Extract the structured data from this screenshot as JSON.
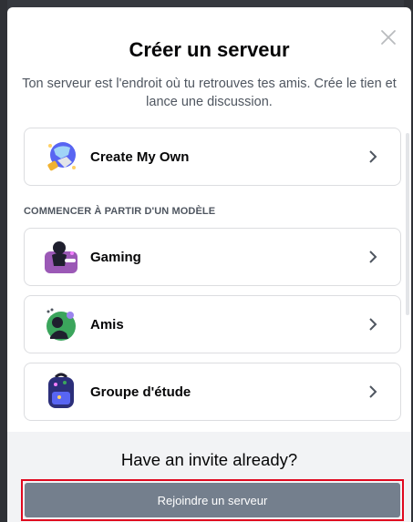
{
  "modal": {
    "title": "Créer un serveur",
    "subtitle": "Ton serveur est l'endroit où tu retrouves tes amis. Crée le tien et lance une discussion."
  },
  "create_own": {
    "label": "Create My Own",
    "icon": "globe-icon"
  },
  "templates": {
    "section_label": "COMMENCER À PARTIR D'UN MODÈLE",
    "items": [
      {
        "label": "Gaming",
        "icon": "gaming-icon"
      },
      {
        "label": "Amis",
        "icon": "friends-icon"
      },
      {
        "label": "Groupe d'étude",
        "icon": "backpack-icon"
      }
    ]
  },
  "footer": {
    "title": "Have an invite already?",
    "join_label": "Rejoindre un serveur"
  },
  "colors": {
    "accent": "#747f8d",
    "highlight_border": "#e0081e",
    "footer_bg": "#f2f3f5"
  }
}
